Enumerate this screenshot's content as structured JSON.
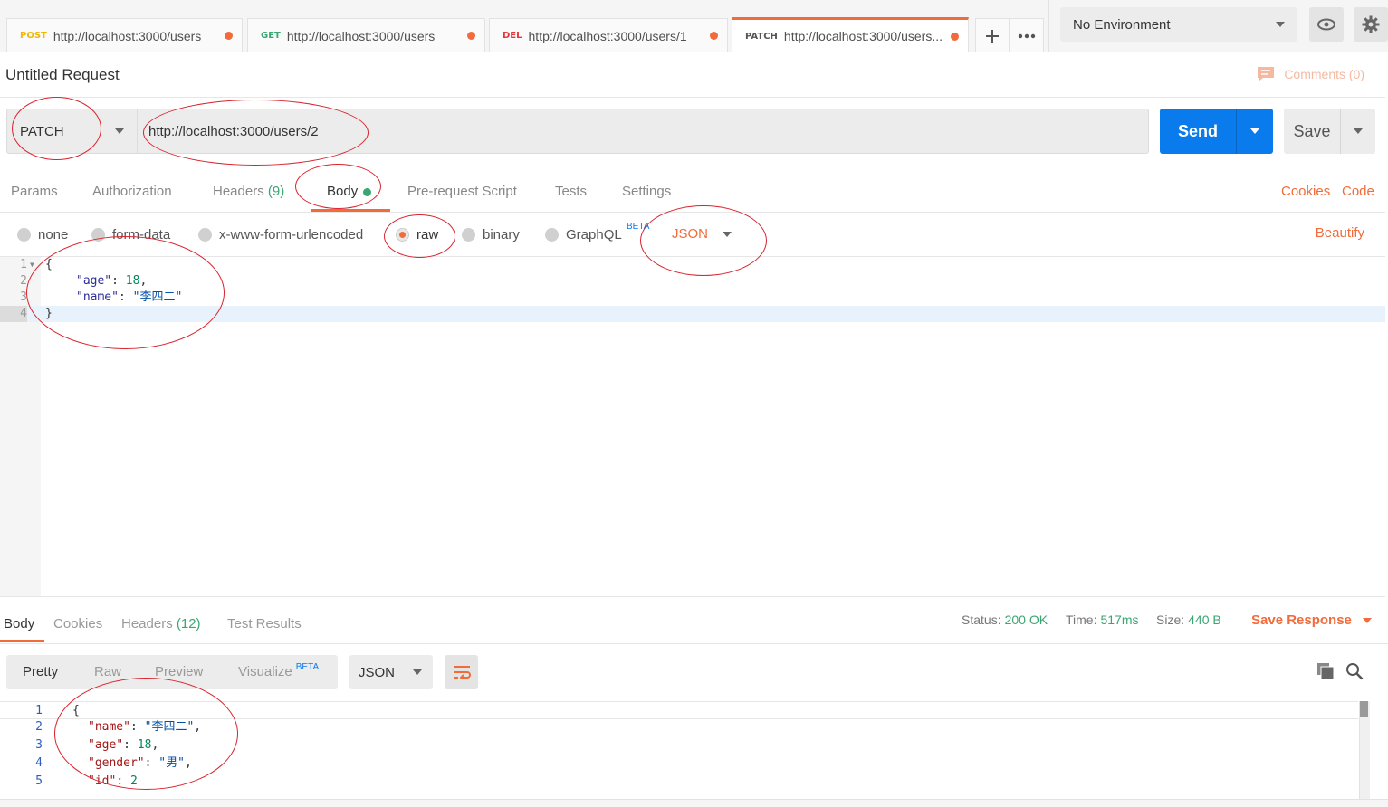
{
  "tabs": [
    {
      "method": "POST",
      "method_color": "#f2b705",
      "url": "http://localhost:3000/users"
    },
    {
      "method": "GET",
      "method_color": "#3aa672",
      "url": "http://localhost:3000/users"
    },
    {
      "method": "DEL",
      "method_color": "#e5343a",
      "url": "http://localhost:3000/users/1"
    },
    {
      "method": "PATCH",
      "method_color": "#555555",
      "url": "http://localhost:3000/users..."
    }
  ],
  "environment": {
    "selected": "No Environment"
  },
  "request": {
    "title": "Untitled Request",
    "comments": "Comments (0)",
    "method": "PATCH",
    "url": "http://localhost:3000/users/2",
    "send_label": "Send",
    "save_label": "Save"
  },
  "request_tabs": {
    "params": "Params",
    "authorization": "Authorization",
    "headers": "Headers",
    "headers_count": "(9)",
    "body": "Body",
    "pre_request": "Pre-request Script",
    "tests": "Tests",
    "settings": "Settings",
    "cookies": "Cookies",
    "code": "Code"
  },
  "body_types": {
    "none": "none",
    "form_data": "form-data",
    "urlencoded": "x-www-form-urlencoded",
    "raw": "raw",
    "binary": "binary",
    "graphql": "GraphQL",
    "beta": "BETA",
    "format": "JSON",
    "beautify": "Beautify"
  },
  "request_body": {
    "line_numbers": [
      "1",
      "2",
      "3",
      "4"
    ],
    "open": "{",
    "k1": "\"age\"",
    "v1": "18",
    "k2": "\"name\"",
    "v2": "\"李四二\"",
    "close": "}"
  },
  "response_tabs": {
    "body": "Body",
    "cookies": "Cookies",
    "headers": "Headers",
    "headers_count": "(12)",
    "test_results": "Test Results"
  },
  "response_meta": {
    "status_label": "Status:",
    "status_value": "200 OK",
    "time_label": "Time:",
    "time_value": "517ms",
    "size_label": "Size:",
    "size_value": "440 B",
    "save_response": "Save Response"
  },
  "response_view": {
    "pretty": "Pretty",
    "raw": "Raw",
    "preview": "Preview",
    "visualize": "Visualize",
    "beta": "BETA",
    "format": "JSON"
  },
  "response_body": {
    "line_numbers": [
      "1",
      "2",
      "3",
      "4",
      "5"
    ],
    "open": "{",
    "k1": "\"name\"",
    "v1": "\"李四二\"",
    "k2": "\"age\"",
    "v2": "18",
    "k3": "\"gender\"",
    "v3": "\"男\"",
    "k4": "\"id\"",
    "v4": "2"
  },
  "colors": {
    "accent": "#f26b3a",
    "primary": "#097bed",
    "success": "#3aa672",
    "annotation": "#d9232e"
  },
  "icons": [
    "plus-icon",
    "more-icon",
    "eye-icon",
    "gear-icon",
    "comment-icon",
    "copy-icon",
    "search-icon",
    "wrap-icon"
  ]
}
